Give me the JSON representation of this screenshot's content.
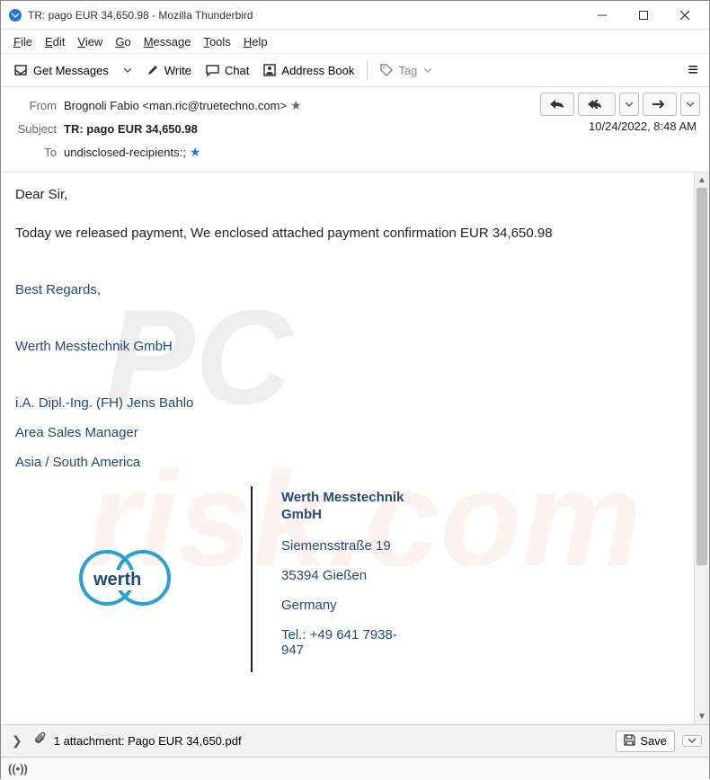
{
  "window": {
    "title": "TR: pago EUR 34,650.98 - Mozilla Thunderbird"
  },
  "menu": {
    "items": [
      "File",
      "Edit",
      "View",
      "Go",
      "Message",
      "Tools",
      "Help"
    ]
  },
  "toolbar": {
    "get_messages": "Get Messages",
    "write": "Write",
    "chat": "Chat",
    "address_book": "Address Book",
    "tag": "Tag"
  },
  "header": {
    "from_label": "From",
    "from_value": "Brognoli Fabio <man.ric@truetechno.com>",
    "subject_label": "Subject",
    "subject_value": "TR: pago EUR 34,650.98",
    "to_label": "To",
    "to_value": "undisclosed-recipients:;",
    "date": "10/24/2022, 8:48 AM"
  },
  "body": {
    "greeting": "Dear Sir,",
    "line1": "Today we released payment, We enclosed attached payment confirmation EUR 34,650.98",
    "regards": "Best Regards,",
    "company": "Werth Messtechnik GmbH",
    "sig_name": "i.A. Dipl.-Ing. (FH) Jens Bahlo",
    "sig_title": "Area Sales Manager",
    "sig_region": "Asia / South America",
    "logo_text": "werth",
    "addr_company": "Werth Messtechnik GmbH",
    "addr_street": "Siemensstraße 19",
    "addr_city": "35394 Gießen",
    "addr_country": "Germany",
    "addr_tel": "Tel.:  +49 641 7938-947"
  },
  "attachment": {
    "text": "1 attachment: Pago EUR 34,650.pdf",
    "save": "Save"
  },
  "icons": {
    "watermark1": "PC",
    "watermark2": "risk.com"
  }
}
